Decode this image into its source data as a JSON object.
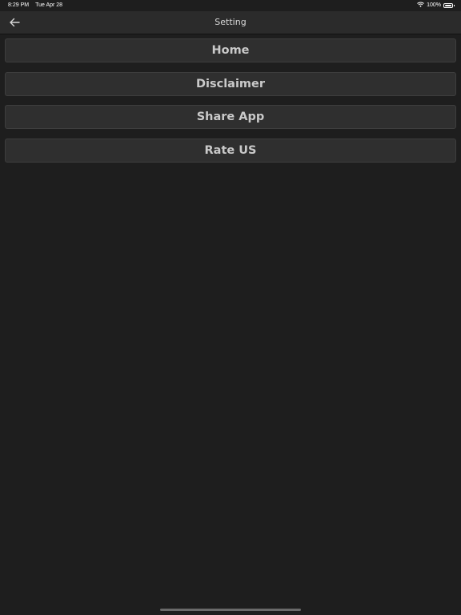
{
  "status_bar": {
    "time": "8:29 PM",
    "date": "Tue Apr 28",
    "battery_text": "100%",
    "battery_level": 1.0
  },
  "nav": {
    "title": "Setting",
    "back_icon": "arrow-left-icon"
  },
  "menu": {
    "items": [
      {
        "label": "Home"
      },
      {
        "label": "Disclaimer"
      },
      {
        "label": "Share App"
      },
      {
        "label": "Rate US"
      }
    ]
  },
  "colors": {
    "background": "#1e1e1e",
    "nav_background": "#2b2b2b",
    "button_background": "#2f2f2f",
    "button_text": "#c9c9c9"
  }
}
